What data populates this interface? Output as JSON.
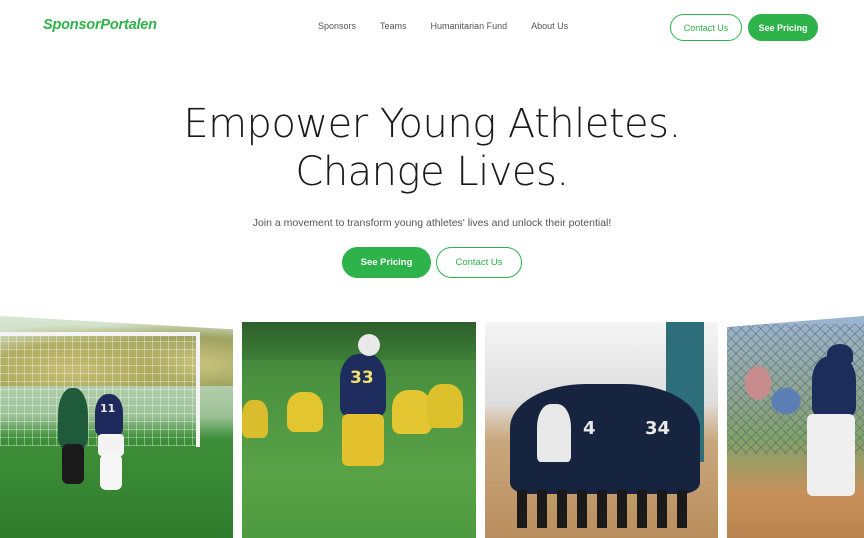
{
  "nav": {
    "logo": "SponsorPortalen",
    "links": [
      "Sponsors",
      "Teams",
      "Humanitarian Fund",
      "About Us"
    ],
    "contact_label": "Contact Us",
    "pricing_label": "See Pricing"
  },
  "hero": {
    "title_line1": "Empower Young Athletes.",
    "title_line2": "Change Lives.",
    "subtitle": "Join a movement to transform young athletes' lives and unlock their potential!",
    "pricing_label": "See Pricing",
    "contact_label": "Contact Us"
  },
  "photos": {
    "football_number": "33",
    "basketball_numbers": [
      "4",
      "34"
    ],
    "soccer_number": "11"
  },
  "colors": {
    "accent": "#2db34a",
    "text": "#1a1a1a",
    "muted": "#555555"
  }
}
